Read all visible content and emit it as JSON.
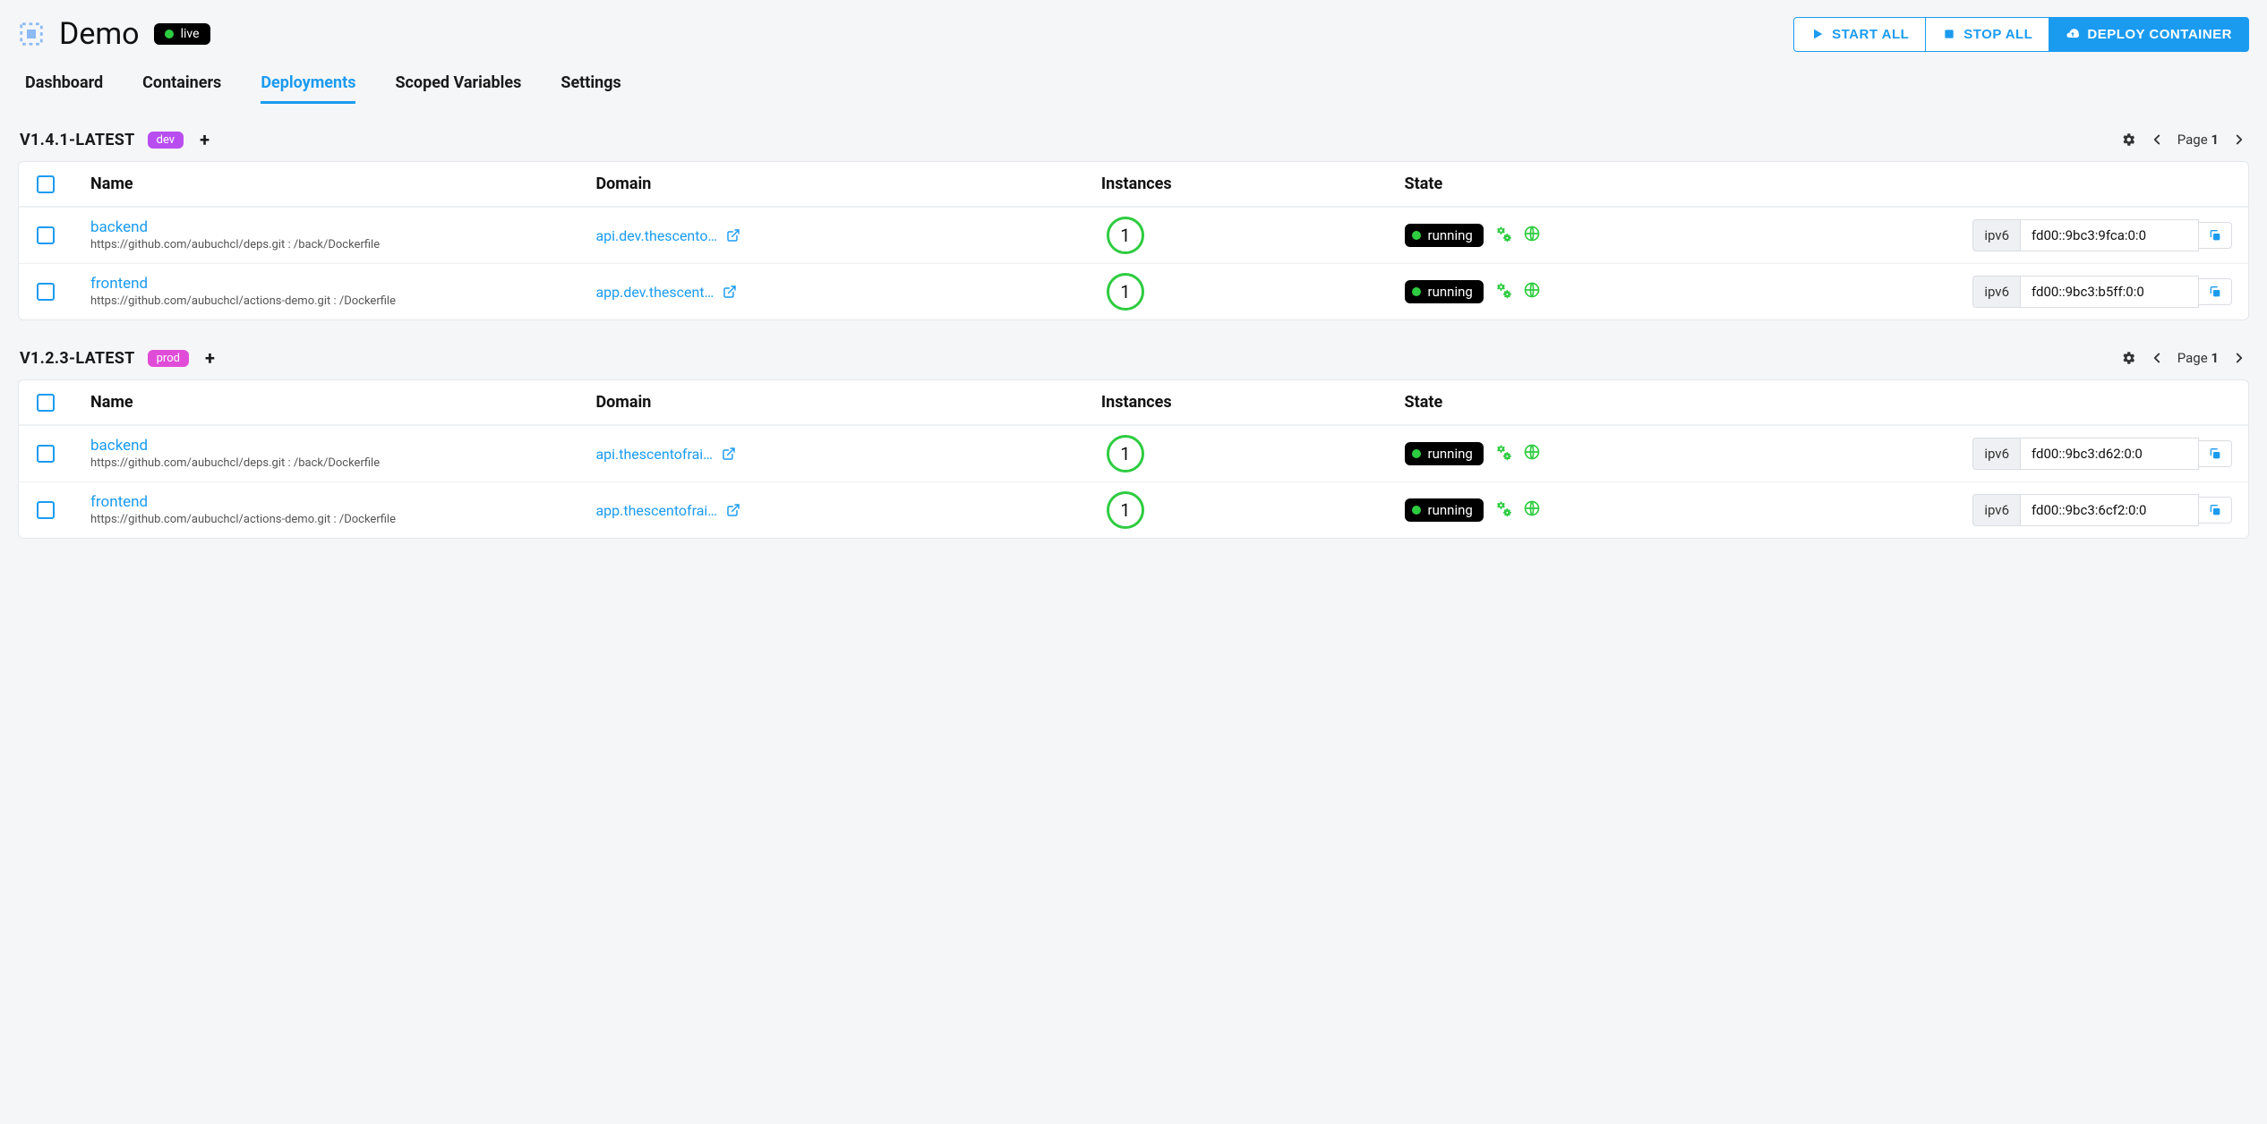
{
  "header": {
    "title": "Demo",
    "status_label": "live",
    "buttons": {
      "start_all": "START ALL",
      "stop_all": "STOP ALL",
      "deploy": "DEPLOY CONTAINER"
    }
  },
  "tabs": {
    "dashboard": "Dashboard",
    "containers": "Containers",
    "deployments": "Deployments",
    "scoped_vars": "Scoped Variables",
    "settings": "Settings",
    "active": "deployments"
  },
  "columns": {
    "name": "Name",
    "domain": "Domain",
    "instances": "Instances",
    "state": "State"
  },
  "pagination": {
    "label": "Page ",
    "number": "1"
  },
  "ip_prefix": "ipv6",
  "sections": [
    {
      "version": "V1.4.1-LATEST",
      "env": "dev",
      "env_class": "env-dev",
      "rows": [
        {
          "name": "backend",
          "sub": "https://github.com/aubuchcl/deps.git : /back/Dockerfile",
          "domain": "api.dev.thescento…",
          "instances": "1",
          "state": "running",
          "ip": "fd00::9bc3:9fca:0:0"
        },
        {
          "name": "frontend",
          "sub": "https://github.com/aubuchcl/actions-demo.git : /Dockerfile",
          "domain": "app.dev.thescent…",
          "instances": "1",
          "state": "running",
          "ip": "fd00::9bc3:b5ff:0:0"
        }
      ]
    },
    {
      "version": "V1.2.3-LATEST",
      "env": "prod",
      "env_class": "env-prod",
      "rows": [
        {
          "name": "backend",
          "sub": "https://github.com/aubuchcl/deps.git : /back/Dockerfile",
          "domain": "api.thescentofrai…",
          "instances": "1",
          "state": "running",
          "ip": "fd00::9bc3:d62:0:0"
        },
        {
          "name": "frontend",
          "sub": "https://github.com/aubuchcl/actions-demo.git : /Dockerfile",
          "domain": "app.thescentofrai…",
          "instances": "1",
          "state": "running",
          "ip": "fd00::9bc3:6cf2:0:0"
        }
      ]
    }
  ]
}
